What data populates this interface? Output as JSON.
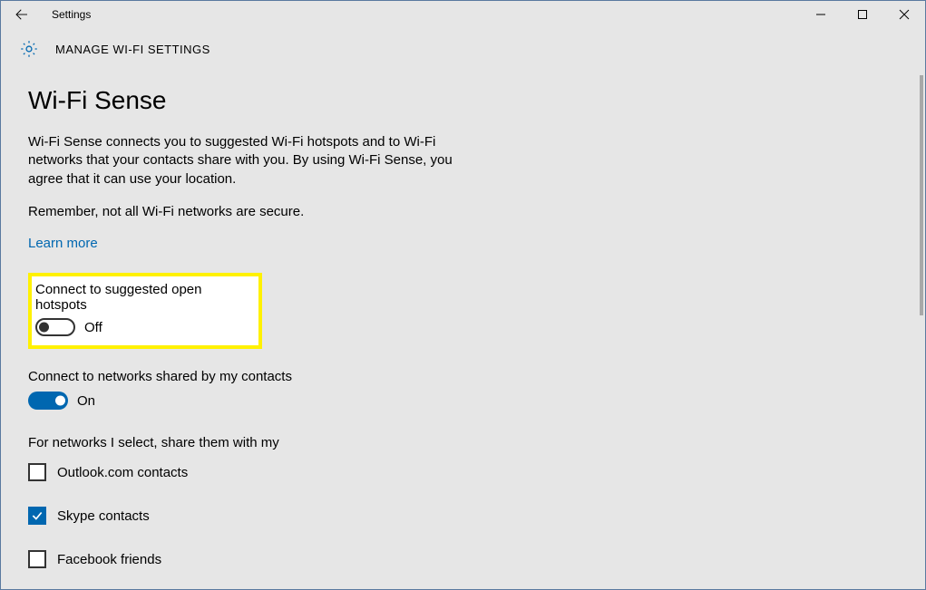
{
  "window": {
    "title": "Settings",
    "header": "MANAGE WI-FI SETTINGS"
  },
  "page": {
    "heading": "Wi-Fi Sense",
    "intro": "Wi-Fi Sense connects you to suggested Wi-Fi hotspots and to Wi-Fi networks that your contacts share with you. By using Wi-Fi Sense, you agree that it can use your location.",
    "secure_note": "Remember, not all Wi-Fi networks are secure.",
    "learn_more": "Learn more"
  },
  "toggles": {
    "open_hotspots": {
      "label": "Connect to suggested open hotspots",
      "state": "Off"
    },
    "shared_contacts": {
      "label": "Connect to networks shared by my contacts",
      "state": "On"
    }
  },
  "share": {
    "heading": "For networks I select, share them with my",
    "outlook": "Outlook.com contacts",
    "skype": "Skype contacts",
    "facebook": "Facebook friends"
  }
}
